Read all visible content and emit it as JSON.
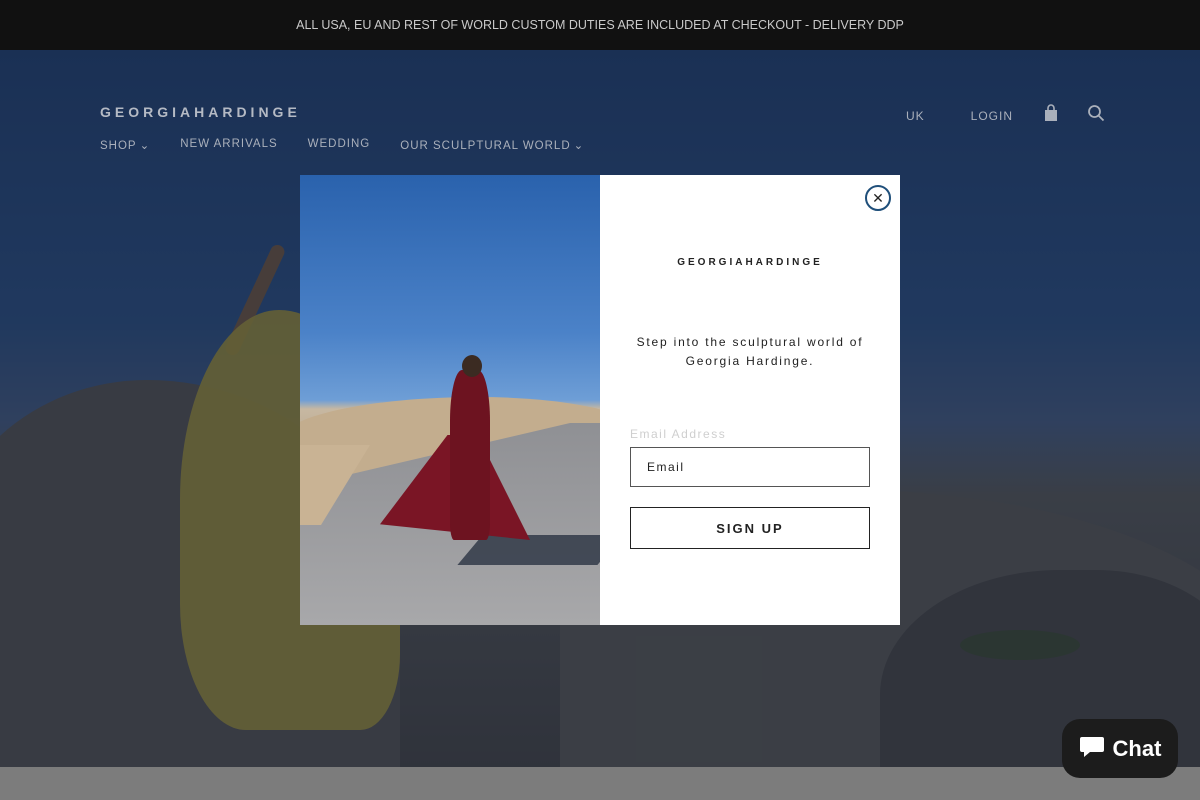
{
  "announcement": "ALL USA, EU AND REST OF WORLD CUSTOM DUTIES ARE INCLUDED AT CHECKOUT - DELIVERY DDP",
  "header": {
    "brand": "GEORGIAHARDINGE",
    "nav": [
      {
        "label": "SHOP",
        "has_dropdown": true
      },
      {
        "label": "NEW ARRIVALS",
        "has_dropdown": false
      },
      {
        "label": "WEDDING",
        "has_dropdown": false
      },
      {
        "label": "OUR SCULPTURAL WORLD",
        "has_dropdown": true
      }
    ],
    "region": "UK",
    "login": "LOGIN",
    "icons": [
      "cart-icon",
      "search-icon"
    ]
  },
  "modal": {
    "brand": "GEORGIAHARDINGE",
    "tagline": "Step into the sculptural world of Georgia Hardinge.",
    "email_label": "Email Address",
    "email_placeholder": "Email",
    "signup_label": "SIGN UP",
    "close_icon": "close-icon"
  },
  "chat": {
    "label": "Chat",
    "icon": "chat-bubble-icon"
  },
  "colors": {
    "announcement_bg": "#111111",
    "modal_bg": "#ffffff",
    "close_ring": "#1f4f7a",
    "chat_bg": "#1c1c1c"
  }
}
